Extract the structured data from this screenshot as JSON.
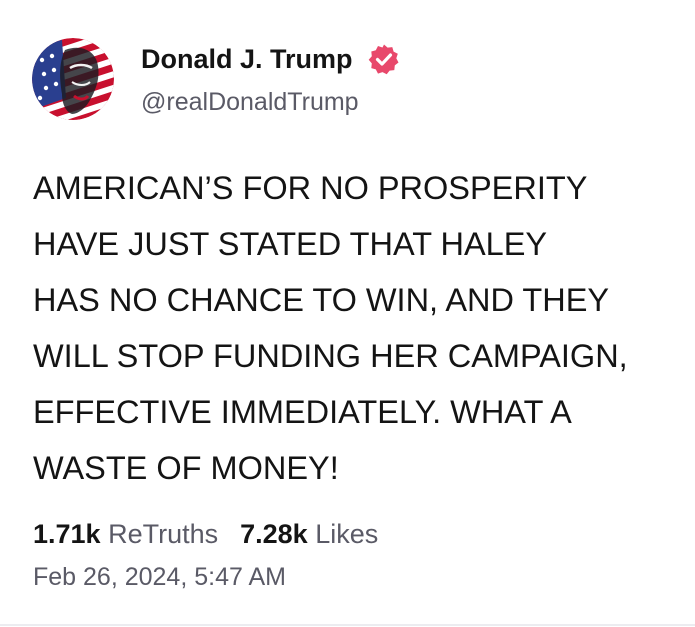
{
  "post": {
    "author": {
      "display_name": "Donald J. Trump",
      "handle": "@realDonaldTrump",
      "verified": true,
      "avatar_icon": "flag-portrait-avatar"
    },
    "body_lines": [
      "AMERICAN’S FOR NO PROSPERITY",
      "HAVE JUST STATED THAT HALEY",
      "HAS NO CHANCE TO WIN, AND THEY",
      "WILL STOP FUNDING HER CAMPAIGN,",
      "EFFECTIVE IMMEDIATELY. WHAT A",
      "WASTE OF MONEY!"
    ],
    "stats": {
      "retruths_count": "1.71k",
      "retruths_label": "ReTruths",
      "likes_count": "7.28k",
      "likes_label": "Likes"
    },
    "timestamp": "Feb 26, 2024, 5:47 AM"
  },
  "colors": {
    "text": "#141414",
    "muted": "#5a5a66",
    "verified_badge": "#e8486b",
    "divider": "#ececf0"
  }
}
